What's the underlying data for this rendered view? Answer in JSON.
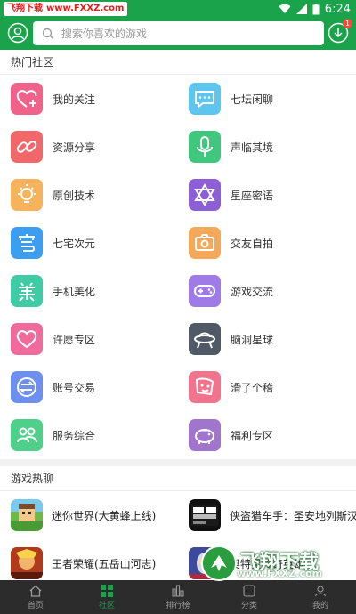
{
  "status_bar": {
    "brand_left": "飞翔下载",
    "brand_url": "www.FXXZ.com",
    "time": "6:24"
  },
  "top_bar": {
    "search_placeholder": "搜索你喜欢的游戏",
    "download_badge": "1"
  },
  "hot_community": {
    "title": "热门社区",
    "items": [
      {
        "label": "我的关注",
        "icon": "heart-plus-icon",
        "color": "#f0628a"
      },
      {
        "label": "七坛闲聊",
        "icon": "chat-bubble-icon",
        "color": "#5cc6ef"
      },
      {
        "label": "资源分享",
        "icon": "link-icon",
        "color": "#f2676a"
      },
      {
        "label": "声临其境",
        "icon": "microphone-icon",
        "color": "#3ec77d"
      },
      {
        "label": "原创技术",
        "icon": "lightbulb-icon",
        "color": "#f7b25c"
      },
      {
        "label": "星座密语",
        "icon": "star-of-david-icon",
        "color": "#8c5fd6"
      },
      {
        "label": "七宅次元",
        "icon": "otaku-icon",
        "color": "#3b9ef0"
      },
      {
        "label": "交友自拍",
        "icon": "camera-icon",
        "color": "#f5a85a"
      },
      {
        "label": "手机美化",
        "icon": "beautify-icon",
        "color": "#3fcba4"
      },
      {
        "label": "游戏交流",
        "icon": "gamepad-icon",
        "color": "#9e7be6"
      },
      {
        "label": "许愿专区",
        "icon": "heart-outline-icon",
        "color": "#f06a9b"
      },
      {
        "label": "脑洞星球",
        "icon": "ufo-icon",
        "color": "#505a66"
      },
      {
        "label": "账号交易",
        "icon": "exchange-icon",
        "color": "#6d8ff0"
      },
      {
        "label": "滑了个稽",
        "icon": "funny-face-icon",
        "color": "#f2748c"
      },
      {
        "label": "服务综合",
        "icon": "people-icon",
        "color": "#4fd08a"
      },
      {
        "label": "福利专区",
        "icon": "piggy-bank-icon",
        "color": "#a175cc"
      }
    ]
  },
  "game_chat": {
    "title": "游戏热聊",
    "items": [
      {
        "label": "迷你世界(大黄蜂上线)",
        "icon": "mini-world-icon"
      },
      {
        "label": "侠盗猎车手：圣安地列斯汉",
        "icon": "gta-icon"
      },
      {
        "label": "王者荣耀(五岳山河志)",
        "icon": "honor-of-kings-icon"
      },
      {
        "label": "奥特曼传奇英雄",
        "icon": "ultraman-icon"
      }
    ]
  },
  "tab_bar": {
    "tabs": [
      {
        "label": "首页",
        "active": false
      },
      {
        "label": "社区",
        "active": true
      },
      {
        "label": "排行榜",
        "active": false
      },
      {
        "label": "分类",
        "active": false
      },
      {
        "label": "我的",
        "active": false
      }
    ]
  },
  "watermark": {
    "text": "飞翔下载",
    "url": "www.FXXZ.com"
  }
}
